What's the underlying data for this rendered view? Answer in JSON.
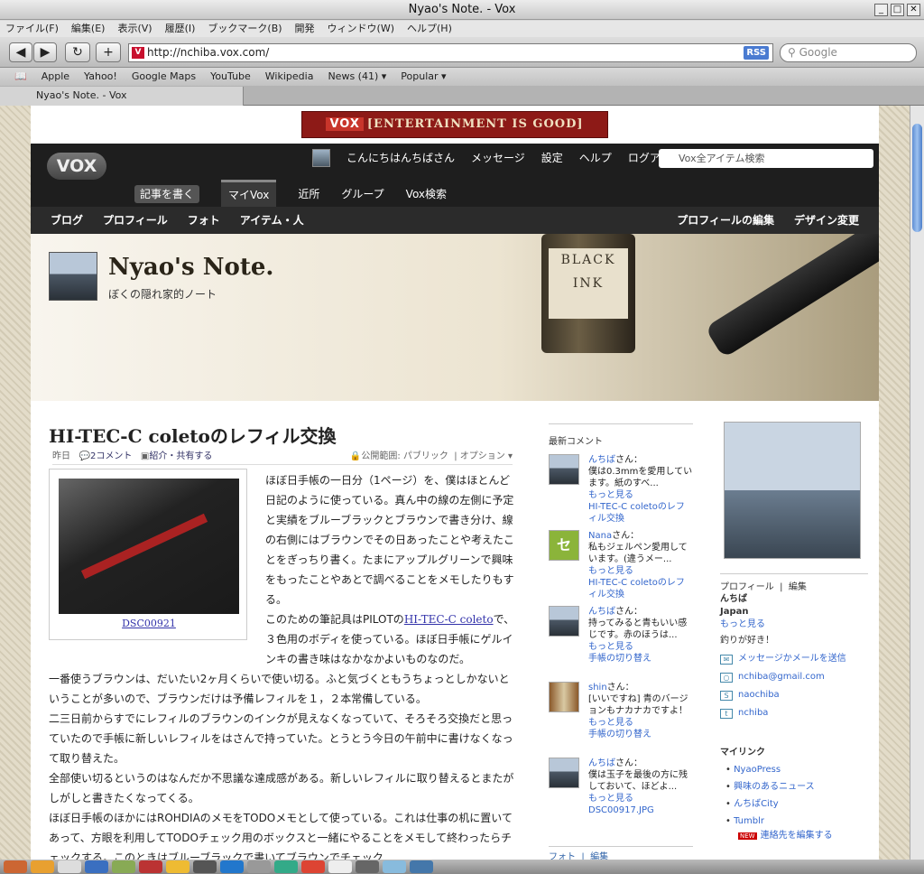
{
  "window": {
    "title": "Nyao's Note. - Vox"
  },
  "menu": [
    "ファイル(F)",
    "編集(E)",
    "表示(V)",
    "履歴(I)",
    "ブックマーク(B)",
    "開発",
    "ウィンドウ(W)",
    "ヘルプ(H)"
  ],
  "nav": {
    "back": "◀",
    "forward": "▶",
    "reload": "↻",
    "add": "+",
    "url": "http://nchiba.vox.com/",
    "rss": "RSS",
    "search_placeholder": "Google"
  },
  "bookmarks": [
    "Apple",
    "Yahoo!",
    "Google Maps",
    "YouTube",
    "Wikipedia",
    "News (41) ▾",
    "Popular ▾"
  ],
  "tab": {
    "label": "Nyao's Note. - Vox"
  },
  "ad": {
    "brand": "VOX",
    "text": "[ENTERTAINMENT IS GOOD]"
  },
  "vox": {
    "logo": "VOX",
    "top": [
      "こんにちはんちばさん",
      "メッセージ",
      "設定",
      "ヘルプ",
      "ログアウト"
    ],
    "search_placeholder": "Vox全アイテム検索",
    "sub": [
      "記事を書く",
      "マイVox",
      "近所",
      "グループ",
      "Vox検索"
    ],
    "blog_left": [
      "ブログ",
      "プロフィール",
      "フォト",
      "アイテム・人"
    ],
    "blog_right": [
      "プロフィールの編集",
      "デザイン変更"
    ]
  },
  "banner": {
    "title": "Nyao's Note.",
    "subtitle": "ぼくの隠れ家的ノート",
    "bottle_label": "BLACK INK"
  },
  "post": {
    "title": "HI-TEC-C coletoのレフィル交換",
    "date": "昨日",
    "comments": "2コメント",
    "share": "紹介・共有する",
    "privacy": "公開範囲: パブリック",
    "options": "オプション ▾",
    "photo_caption": "DSC00921",
    "p1": "ほぼ日手帳の一日分（1ページ）を、僕はほとんど日記のように使っている。真ん中の線の左側に予定と実績をブルーブラックとブラウンで書き分け、線の右側にはブラウンでその日あったことや考えたことをぎっちり書く。たまにアップルグリーンで興味をもったことやあとで調べることをメモしたりもする。",
    "p2a": "このための筆記具はPILOTの",
    "p2link": "HI-TEC-C coleto",
    "p2b": "で、３色用のボディを使っている。ほぼ日手帳にゲルインキの書き味はなかなかよいものなのだ。",
    "p3": "一番使うブラウンは、だいたい2ヶ月くらいで使い切る。ふと気づくともうちょっとしかないということが多いので、ブラウンだけは予備レフィルを１，２本常備している。",
    "p4": "二三日前からすでにレフィルのブラウンのインクが見えなくなっていて、そろそろ交換だと思っていたので手帳に新しいレフィルをはさんで持っていた。とうとう今日の午前中に書けなくなって取り替えた。",
    "p5": "全部使い切るというのはなんだか不思議な達成感がある。新しいレフィルに取り替えるとまたがしがしと書きたくなってくる。",
    "p6": "ほぼ日手帳のほかにはROHDIAのメモをTODOメモとして使っている。これは仕事の机に置いてあって、方眼を利用してTODOチェック用のボックスと一緒にやることをメモして終わったらチェックする。このときはブルーブラックで書いてブラウンでチェック"
  },
  "recent_comments": {
    "heading": "最新コメント",
    "items": [
      {
        "name": "んちば",
        "suffix": "さん：",
        "text": "僕は0.3mmを愛用しています。紙のすべ...",
        "more": "もっと見る",
        "entry": "HI-TEC-C coletoのレフィル交換",
        "thumb": ""
      },
      {
        "name": "Nana",
        "suffix": "さん：",
        "text": "私もジェルペン愛用しています。(違うメー...",
        "more": "もっと見る",
        "entry": "HI-TEC-C coletoのレフィル交換",
        "thumb": "セ"
      },
      {
        "name": "んちば",
        "suffix": "さん：",
        "text": "持ってみると青もいい感じです。赤のほうは...",
        "more": "もっと見る",
        "entry": "手帳の切り替え",
        "thumb": ""
      },
      {
        "name": "shin",
        "suffix": "さん：",
        "text": "[いいですね] 青のバージョンもナカナカですよ！",
        "more": "もっと見る",
        "entry": "手帳の切り替え",
        "thumb": ""
      },
      {
        "name": "んちば",
        "suffix": "さん：",
        "text": "僕は玉子を最後の方に残しておいて、ほどよ...",
        "more": "もっと見る",
        "entry": "DSC00917.JPG",
        "thumb": ""
      }
    ]
  },
  "profile": {
    "heading": "プロフィール",
    "edit": "編集",
    "name": "んちば",
    "country": "Japan",
    "more": "もっと見る",
    "bio": "釣りが好き！",
    "message": "メッセージかメールを送信",
    "email": "nchiba@gmail.com",
    "skype": "naochiba",
    "twitter": "nchiba"
  },
  "mylinks": {
    "heading": "マイリンク",
    "items": [
      "NyaoPress",
      "興味のあるニュース",
      "んちばCity",
      "Tumblr"
    ],
    "edit": "連絡先を編集する",
    "new_badge": "NEW"
  },
  "photos": {
    "heading": "フォト",
    "edit": "編集"
  }
}
